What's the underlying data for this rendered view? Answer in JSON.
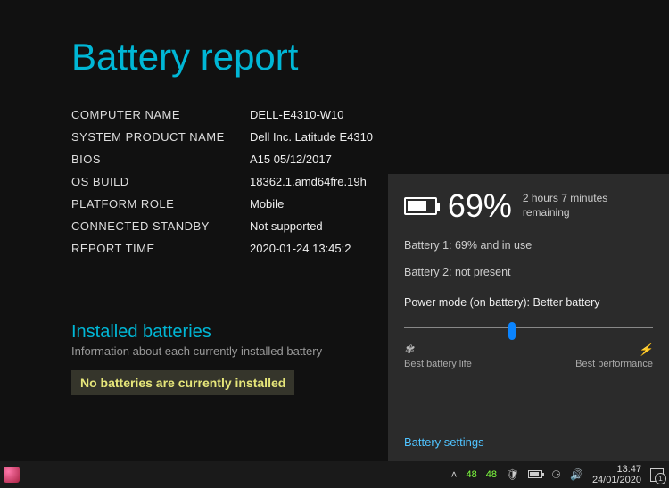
{
  "report": {
    "title": "Battery report",
    "rows": [
      {
        "label": "COMPUTER NAME",
        "value": "DELL-E4310-W10"
      },
      {
        "label": "SYSTEM PRODUCT NAME",
        "value": "Dell Inc. Latitude E4310"
      },
      {
        "label": "BIOS",
        "value": "A15 05/12/2017"
      },
      {
        "label": "OS BUILD",
        "value": "18362.1.amd64fre.19h"
      },
      {
        "label": "PLATFORM ROLE",
        "value": "Mobile"
      },
      {
        "label": "CONNECTED STANDBY",
        "value": "Not supported"
      },
      {
        "label": "REPORT TIME",
        "value": "2020-01-24  13:45:2"
      }
    ],
    "installed": {
      "title": "Installed batteries",
      "desc": "Information about each currently installed battery",
      "none": "No batteries are currently installed"
    }
  },
  "flyout": {
    "percent": "69%",
    "remaining": "2 hours 7 minutes remaining",
    "line1": "Battery 1: 69% and in use",
    "line2": "Battery 2: not present",
    "power_mode_label": "Power mode (on battery): Better battery",
    "slider_left": "Best battery life",
    "slider_right": "Best performance",
    "settings_link": "Battery settings"
  },
  "taskbar": {
    "temps": {
      "a": "48",
      "b": "48"
    },
    "time": "13:47",
    "date": "24/01/2020",
    "notif_count": "1"
  }
}
